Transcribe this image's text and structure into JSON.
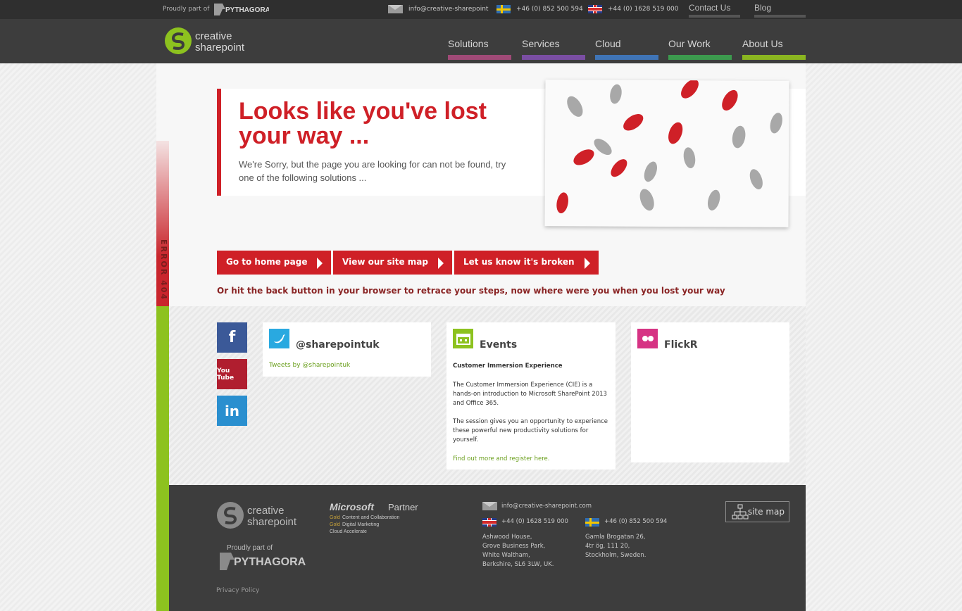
{
  "topbar": {
    "proudly": "Proudly part of",
    "pythagoras": "PYTHAGORAS",
    "email": "info@creative-sharepoint",
    "phone_se": "+46 (0) 852 500 594",
    "phone_uk": "+44 (0) 1628 519 000",
    "contact_us": "Contact Us",
    "blog": "Blog"
  },
  "header": {
    "logo_line1": "creative",
    "logo_line2": "sharepoint",
    "nav": [
      {
        "label": "Solutions",
        "color": "#a04a77"
      },
      {
        "label": "Services",
        "color": "#7a4ea3"
      },
      {
        "label": "Cloud",
        "color": "#3f74b6"
      },
      {
        "label": "Our Work",
        "color": "#3c9a4e"
      },
      {
        "label": "About Us",
        "color": "#8ab520"
      }
    ]
  },
  "error": {
    "side_label": "ERROR 404",
    "title": "Looks like you've lost your way ...",
    "subtitle": "We're Sorry, but the page you are looking for can not be found, try one of the following solutions ...",
    "buttons": [
      "Go to home page",
      "View our site map",
      "Let us know it's broken"
    ],
    "back_text": "Or hit the back button in your browser to retrace your steps, now where were you when you lost your way"
  },
  "social": {
    "twitter_title": "@sharepointuk",
    "twitter_link": "Tweets by @sharepointuk",
    "events_title": "Events",
    "events_heading": "Customer Immersion Experience",
    "events_p1": "The Customer Immersion Experience (CIE) is a hands-on introduction to Microsoft SharePoint 2013 and Office 365.",
    "events_p2": "The session gives you an opportunity to experience these powerful new productivity solutions for yourself.",
    "events_link": "Find out more and register here.",
    "flickr_title": "FlickR",
    "fb_icon": "f",
    "yt_icon": "You Tube",
    "li_icon": "in"
  },
  "footer": {
    "logo_line1": "creative",
    "logo_line2": "sharepoint",
    "proudly": "Proudly part of",
    "pythagoras": "PYTHAGORAS",
    "partner_brand": "Microsoft",
    "partner_word": "Partner",
    "partner_lines": [
      "Content and Collaboration",
      "Digital Marketing",
      "Cloud Accelerate"
    ],
    "partner_gold": "Gold",
    "email": "info@creative-sharepoint.com",
    "phone_uk": "+44 (0) 1628 519 000",
    "phone_se": "+46 (0) 852 500 594",
    "address_uk": [
      "Ashwood House,",
      "Grove Business Park,",
      "White Waltham,",
      "Berkshire, SL6 3LW, UK."
    ],
    "address_se": [
      "Gamla Brogatan 26,",
      "4tr ög, 111 20,",
      "Stockholm, Sweden."
    ],
    "sitemap": "site map",
    "privacy": "Privacy Policy"
  }
}
